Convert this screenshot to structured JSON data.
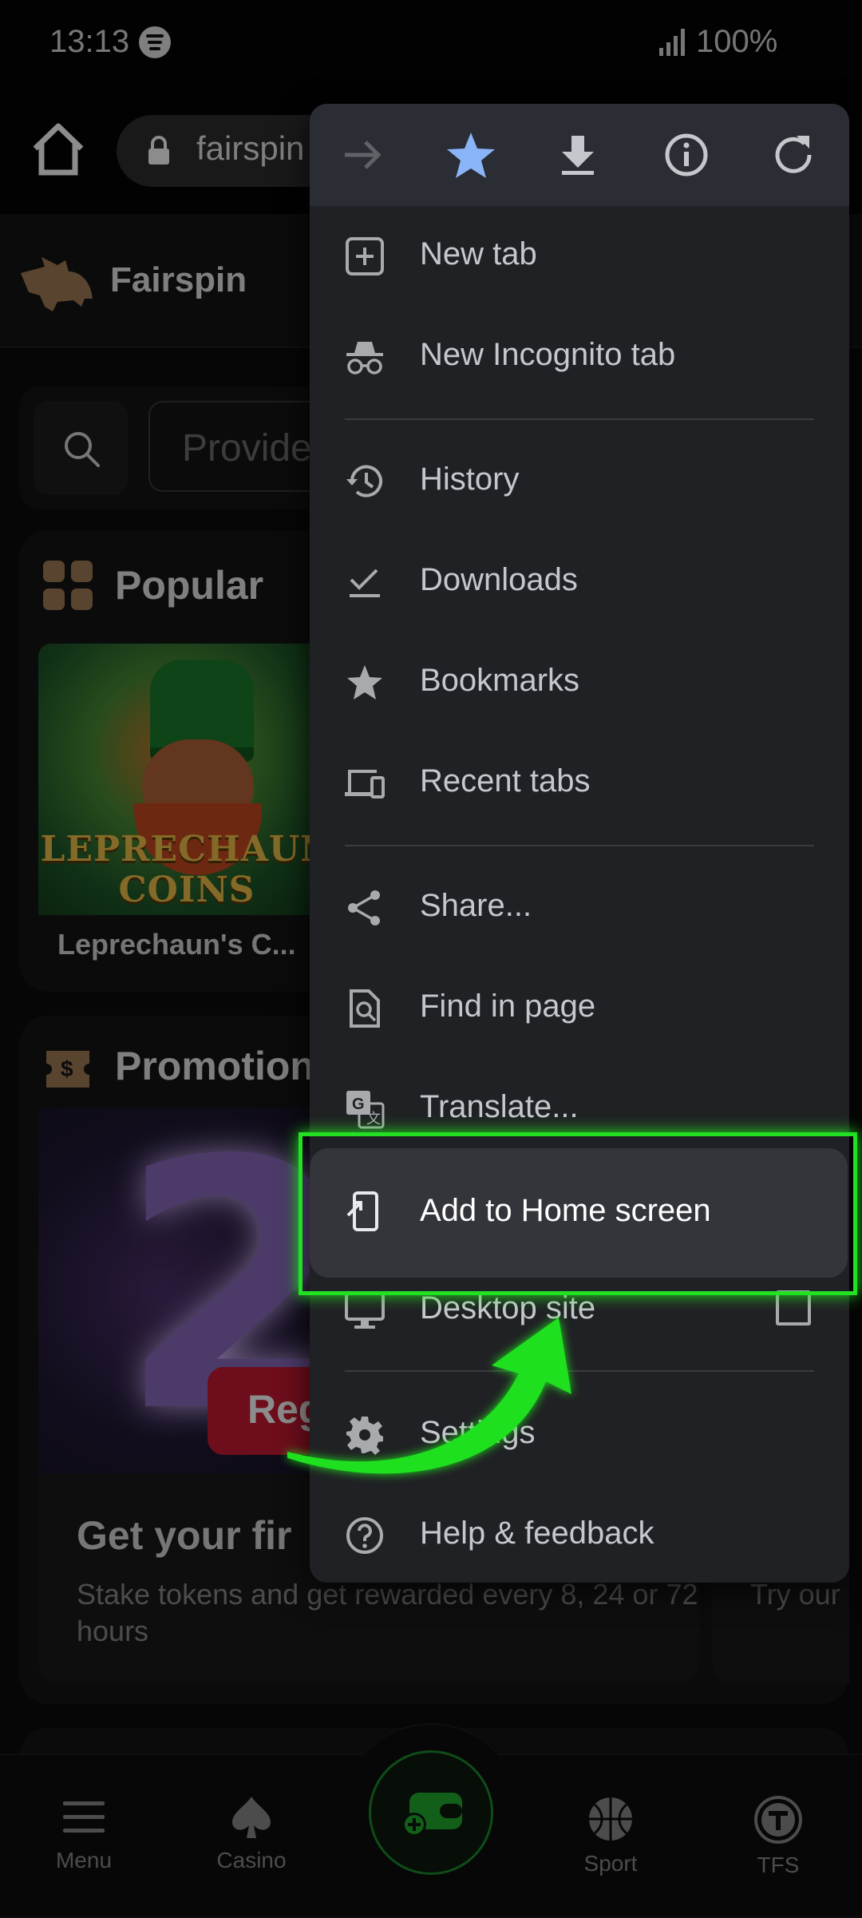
{
  "status_bar": {
    "time": "13:13",
    "battery": "100%"
  },
  "browser": {
    "url": "fairspin"
  },
  "site": {
    "name": "Fairspin",
    "search_placeholder": "Provide",
    "popular": {
      "title": "Popular",
      "games": [
        {
          "name": "Leprechaun's C...",
          "art_text": "LEPRECHAUN COINS"
        }
      ]
    },
    "promotions": {
      "title": "Promotion",
      "banner_number": "2",
      "banner_button": "Regi",
      "card_title": "Get your fir",
      "card_desc": "Stake tokens and get rewarded every 8, 24 or 72 hours",
      "side_card_text": "Try our"
    }
  },
  "bottom_nav": [
    {
      "label": "Menu",
      "icon": "hamburger-icon"
    },
    {
      "label": "Casino",
      "icon": "spade-icon"
    },
    {
      "label": "",
      "icon": "wallet-add-icon"
    },
    {
      "label": "Sport",
      "icon": "basketball-icon"
    },
    {
      "label": "TFS",
      "icon": "tfs-coin-icon"
    }
  ],
  "menu": {
    "top_icons": [
      "forward-icon",
      "star-icon",
      "download-icon",
      "info-icon",
      "refresh-icon"
    ],
    "items": [
      {
        "label": "New tab",
        "icon": "new-tab-icon"
      },
      {
        "label": "New Incognito tab",
        "icon": "incognito-icon"
      },
      {
        "label": "History",
        "icon": "history-icon"
      },
      {
        "label": "Downloads",
        "icon": "downloads-icon"
      },
      {
        "label": "Bookmarks",
        "icon": "bookmarks-star-icon"
      },
      {
        "label": "Recent tabs",
        "icon": "devices-icon"
      },
      {
        "label": "Share...",
        "icon": "share-icon"
      },
      {
        "label": "Find in page",
        "icon": "find-in-page-icon"
      },
      {
        "label": "Translate...",
        "icon": "translate-icon"
      },
      {
        "label": "Add to Home screen",
        "icon": "add-to-home-icon",
        "highlighted": true
      },
      {
        "label": "Desktop site",
        "icon": "desktop-icon",
        "checkbox": false
      },
      {
        "label": "Settings",
        "icon": "settings-gear-icon"
      },
      {
        "label": "Help & feedback",
        "icon": "help-icon"
      }
    ]
  },
  "colors": {
    "highlight": "#22e022",
    "menu_bg": "#202124",
    "accent_star": "#8ab4f8"
  }
}
